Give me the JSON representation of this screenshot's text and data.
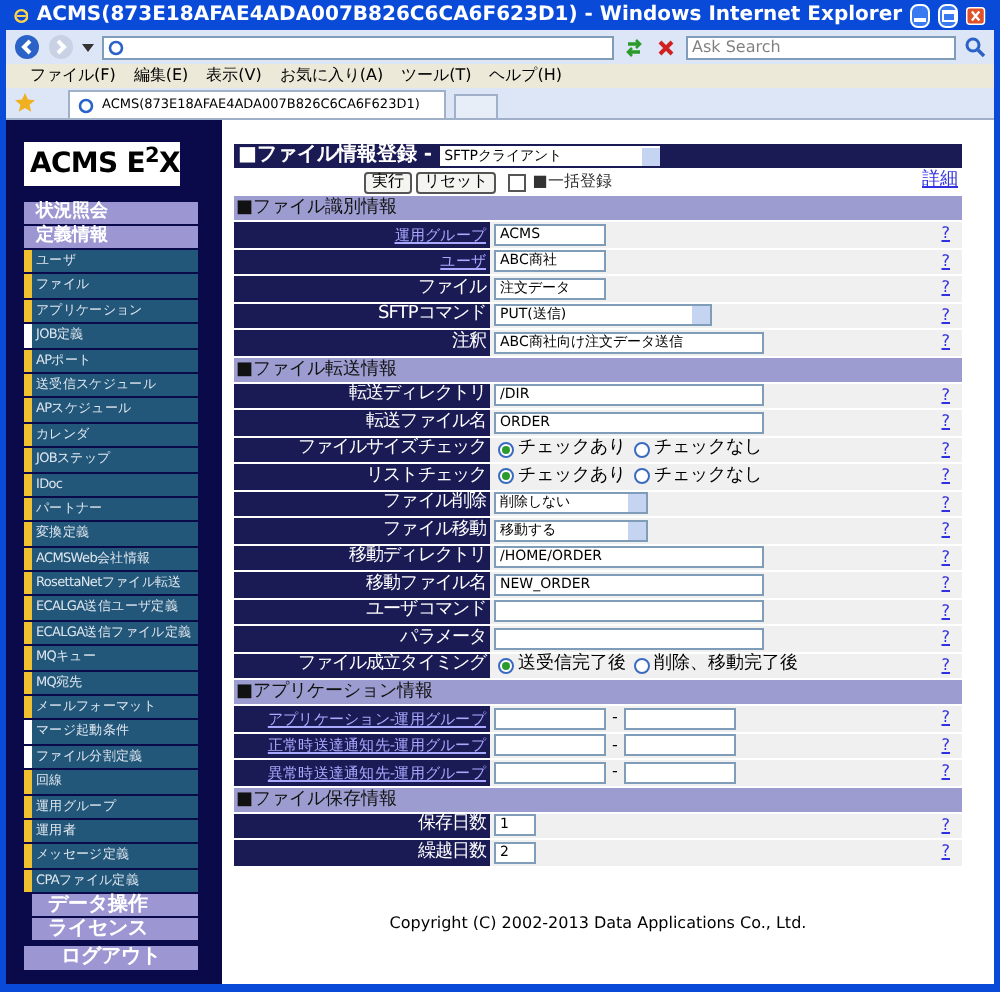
{
  "browser": {
    "title": "ACMS(873E18AFAE4ADA007B826C6CA6F623D1) - Windows Internet Explorer",
    "search_placeholder": "Ask Search",
    "menu": [
      "ファイル(F)",
      "編集(E)",
      "表示(V)",
      "お気に入り(A)",
      "ツール(T)",
      "ヘルプ(H)"
    ],
    "tab": "ACMS(873E18AFAE4ADA007B826C6CA6F623D1)"
  },
  "sidebar": {
    "logo": "ACMS E$^{2}$X",
    "headers_top": [
      "状況照会",
      "定義情報"
    ],
    "items": [
      {
        "label": "ユーザ",
        "color": "#f0c030"
      },
      {
        "label": "ファイル",
        "color": "#f0c030"
      },
      {
        "label": "アプリケーション",
        "color": "#f0c030"
      },
      {
        "label": "JOB定義",
        "color": "#ffffff"
      },
      {
        "label": "APポート",
        "color": "#f0c030"
      },
      {
        "label": "送受信スケジュール",
        "color": "#f0c030"
      },
      {
        "label": "APスケジュール",
        "color": "#f0c030"
      },
      {
        "label": "カレンダ",
        "color": "#f0c030"
      },
      {
        "label": "JOBステップ",
        "color": "#f0c030"
      },
      {
        "label": "IDoc",
        "color": "#f0c030"
      },
      {
        "label": "パートナー",
        "color": "#f0c030"
      },
      {
        "label": "変換定義",
        "color": "#f0c030"
      },
      {
        "label": "ACMSWeb会社情報",
        "color": "#f0c030"
      },
      {
        "label": "RosettaNetファイル転送",
        "color": "#f0c030"
      },
      {
        "label": "ECALGA送信ユーザ定義",
        "color": "#f0c030"
      },
      {
        "label": "ECALGA送信ファイル定義",
        "color": "#f0c030"
      },
      {
        "label": "MQキュー",
        "color": "#f0c030"
      },
      {
        "label": "MQ宛先",
        "color": "#f0c030"
      },
      {
        "label": "メールフォーマット",
        "color": "#f0c030"
      },
      {
        "label": "マージ起動条件",
        "color": "#ffffff"
      },
      {
        "label": "ファイル分割定義",
        "color": "#ffffff"
      },
      {
        "label": "回線",
        "color": "#f0c030"
      },
      {
        "label": "運用グループ",
        "color": "#f0c030"
      },
      {
        "label": "運用者",
        "color": "#f0c030"
      },
      {
        "label": "メッセージ定義",
        "color": "#f0c030"
      },
      {
        "label": "CPAファイル定義",
        "color": "#f0c030"
      }
    ],
    "headers_bottom": [
      "データ操作",
      "ライセンス"
    ],
    "logout": "ログアウト"
  },
  "form": {
    "title": "■ファイル情報登録 -",
    "type_select": "SFTPクライアント",
    "buttons": [
      "実行",
      "リセット"
    ],
    "bulk": {
      "label": "■一括登録",
      "checked": false
    },
    "detail_link": "詳細",
    "sections": [
      {
        "title": "■ファイル識別情報",
        "rows": [
          {
            "label": "運用グループ",
            "link": true,
            "kind": "field",
            "value": "ACMS",
            "help": "?"
          },
          {
            "label": "ユーザ",
            "link": true,
            "kind": "field",
            "value": "ABC商社",
            "help": "?"
          },
          {
            "label": "ファイル",
            "link": false,
            "kind": "field",
            "value": "注文データ",
            "help": "?"
          },
          {
            "label": "SFTPコマンド",
            "link": false,
            "kind": "wideselect",
            "value": "PUT(送信)",
            "help": "?"
          },
          {
            "label": "注釈",
            "link": false,
            "kind": "widefield",
            "value": "ABC商社向け注文データ送信",
            "help": "?"
          }
        ]
      },
      {
        "title": "■ファイル転送情報",
        "rows": [
          {
            "label": "転送ディレクトリ",
            "link": false,
            "kind": "widefield",
            "value": "/DIR",
            "help": "?"
          },
          {
            "label": "転送ファイル名",
            "link": false,
            "kind": "widefield",
            "value": "ORDER",
            "help": "?"
          },
          {
            "label": "ファイルサイズチェック",
            "link": false,
            "kind": "radio",
            "options": [
              {
                "label": "チェックあり",
                "selected": true
              },
              {
                "label": "チェックなし",
                "selected": false
              }
            ],
            "help": "?"
          },
          {
            "label": "リストチェック",
            "link": false,
            "kind": "radio",
            "options": [
              {
                "label": "チェックあり",
                "selected": true
              },
              {
                "label": "チェックなし",
                "selected": false
              }
            ],
            "help": "?"
          },
          {
            "label": "ファイル削除",
            "link": false,
            "kind": "select",
            "value": "削除しない",
            "help": "?"
          },
          {
            "label": "ファイル移動",
            "link": false,
            "kind": "select",
            "value": "移動する",
            "help": "?"
          },
          {
            "label": "移動ディレクトリ",
            "link": false,
            "kind": "widefield",
            "value": "/HOME/ORDER",
            "help": "?"
          },
          {
            "label": "移動ファイル名",
            "link": false,
            "kind": "widefield",
            "value": "NEW_ORDER",
            "help": "?"
          },
          {
            "label": "ユーザコマンド",
            "link": false,
            "kind": "widefield",
            "help": "?"
          },
          {
            "label": "パラメータ",
            "link": false,
            "kind": "widefield",
            "help": "?"
          },
          {
            "label": "ファイル成立タイミング",
            "link": false,
            "kind": "radio",
            "options": [
              {
                "label": "送受信完了後",
                "selected": true
              },
              {
                "label": "削除、移動完了後",
                "selected": false
              }
            ],
            "help": "?"
          }
        ]
      },
      {
        "title": "■アプリケーション情報",
        "rows": [
          {
            "label": "アプリケーション-運用グループ",
            "link": true,
            "kind": "pair",
            "separator": "-",
            "help": "?"
          },
          {
            "label": "正常時送達通知先-運用グループ",
            "link": true,
            "kind": "pair",
            "separator": "-",
            "help": "?"
          },
          {
            "label": "異常時送達通知先-運用グループ",
            "link": true,
            "kind": "pair",
            "separator": "-",
            "help": "?"
          }
        ]
      },
      {
        "title": "■ファイル保存情報",
        "rows": [
          {
            "label": "保存日数",
            "link": false,
            "kind": "count",
            "value": "1",
            "help": "?"
          },
          {
            "label": "繰越日数",
            "link": false,
            "kind": "count",
            "value": "2",
            "help": "?"
          }
        ]
      }
    ],
    "copyright": "Copyright (C) 2002-2013 Data Applications Co., Ltd."
  }
}
